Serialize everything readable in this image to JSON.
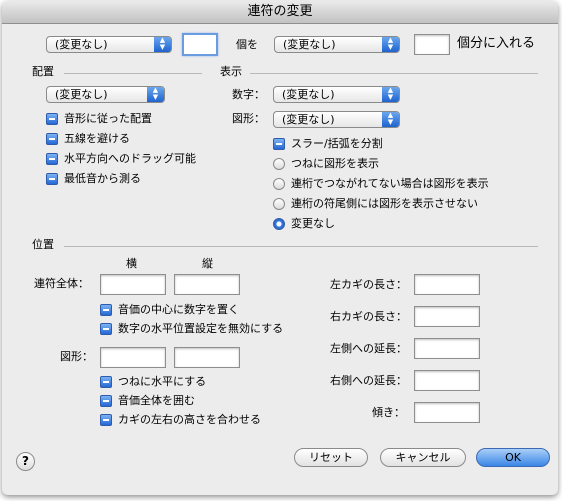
{
  "window": {
    "title": "連符の変更"
  },
  "top_row": {
    "popup_left": "(変更なし)",
    "count_value": "",
    "label_ko": "個を",
    "popup_right": "(変更なし)",
    "count2_value": "",
    "label_into": "個分に入れる"
  },
  "placement": {
    "heading": "配置",
    "popup": "(変更なし)",
    "checkboxes": [
      "音形に従った配置",
      "五線を避ける",
      "水平方向へのドラッグ可能",
      "最低音から測る"
    ]
  },
  "display": {
    "heading": "表示",
    "number_label": "数字：",
    "number_popup": "(変更なし)",
    "shape_label": "図形：",
    "shape_popup": "(変更なし)",
    "split_checkbox": "スラー/括弧を分割",
    "radios": [
      "つねに図形を表示",
      "連桁でつながれてない場合は図形を表示",
      "連桁の符尾側には図形を表示させない",
      "変更なし"
    ],
    "selected_radio": "変更なし"
  },
  "position": {
    "heading": "位置",
    "col_h": "横",
    "col_v": "縦",
    "whole_label": "連符全体：",
    "whole_h": "",
    "whole_v": "",
    "checkboxes1": [
      "音価の中心に数字を置く",
      "数字の水平位置設定を無効にする"
    ],
    "shape_label": "図形：",
    "shape_h": "",
    "shape_v": "",
    "checkboxes2": [
      "つねに水平にする",
      "音価全体を囲む",
      "カギの左右の高さを合わせる"
    ],
    "right_fields": [
      {
        "label": "左カギの長さ：",
        "value": ""
      },
      {
        "label": "右カギの長さ：",
        "value": ""
      },
      {
        "label": "左側への延長：",
        "value": ""
      },
      {
        "label": "右側への延長：",
        "value": ""
      },
      {
        "label": "傾き：",
        "value": ""
      }
    ]
  },
  "buttons": {
    "reset": "リセット",
    "cancel": "キャンセル",
    "ok": "OK",
    "help": "?"
  }
}
